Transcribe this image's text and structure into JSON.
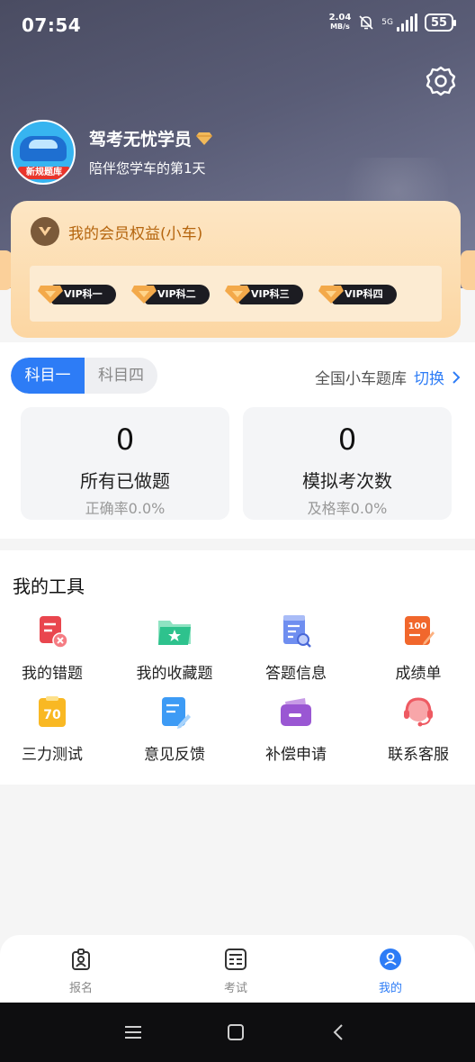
{
  "status_bar": {
    "time": "07:54",
    "speed_value": "2.04",
    "speed_unit": "MB/s",
    "network": "5G",
    "battery": "55"
  },
  "profile": {
    "name": "驾考无忧学员",
    "subtitle": "陪伴您学车的第1天",
    "avatar_tag": "新规题库"
  },
  "vip": {
    "title": "我的会员权益(小车)",
    "chips": [
      "VIP科一",
      "VIP科二",
      "VIP科三",
      "VIP科四"
    ]
  },
  "subject_tabs": {
    "active": "科目一",
    "inactive": "科目四"
  },
  "bank": {
    "label": "全国小车题库",
    "switch": "切换"
  },
  "stats": [
    {
      "value": "0",
      "label": "所有已做题",
      "sub": "正确率0.0%"
    },
    {
      "value": "0",
      "label": "模拟考次数",
      "sub": "及格率0.0%"
    }
  ],
  "tools": {
    "title": "我的工具",
    "items": [
      {
        "label": "我的错题",
        "icon": "wrong-questions-icon"
      },
      {
        "label": "我的收藏题",
        "icon": "favorites-folder-icon"
      },
      {
        "label": "答题信息",
        "icon": "answer-info-icon"
      },
      {
        "label": "成绩单",
        "icon": "score-report-icon"
      },
      {
        "label": "三力测试",
        "icon": "three-ability-test-icon"
      },
      {
        "label": "意见反馈",
        "icon": "feedback-icon"
      },
      {
        "label": "补偿申请",
        "icon": "wallet-icon"
      },
      {
        "label": "联系客服",
        "icon": "customer-service-icon"
      }
    ],
    "score_icon_text": "100",
    "three_test_icon_text": "70"
  },
  "bottom_nav": {
    "items": [
      "报名",
      "考试",
      "我的"
    ],
    "active": "我的"
  },
  "colors": {
    "accent": "#2d7cf6",
    "vip_text": "#b5650e",
    "header": "#4a4c62"
  }
}
